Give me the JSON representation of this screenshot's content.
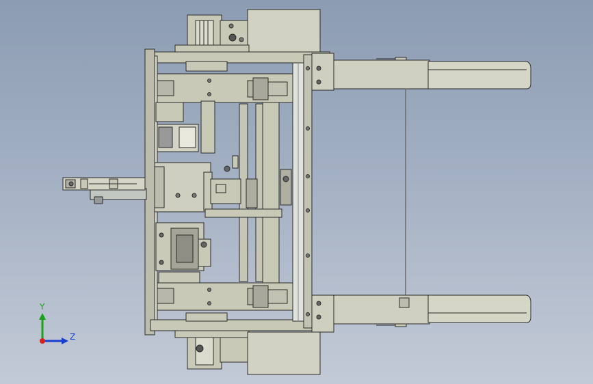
{
  "triad": {
    "y_label": "Y",
    "z_label": "Z",
    "y_color": "#1aa31a",
    "z_color": "#1a3fd0",
    "origin_color": "#d42020"
  },
  "colors": {
    "metal": "#c9c9b8",
    "metal_light": "#d7d7c8",
    "metal_dark": "#a9a99b",
    "outline": "#2a2a2a",
    "rail": "#b9bdb8"
  }
}
